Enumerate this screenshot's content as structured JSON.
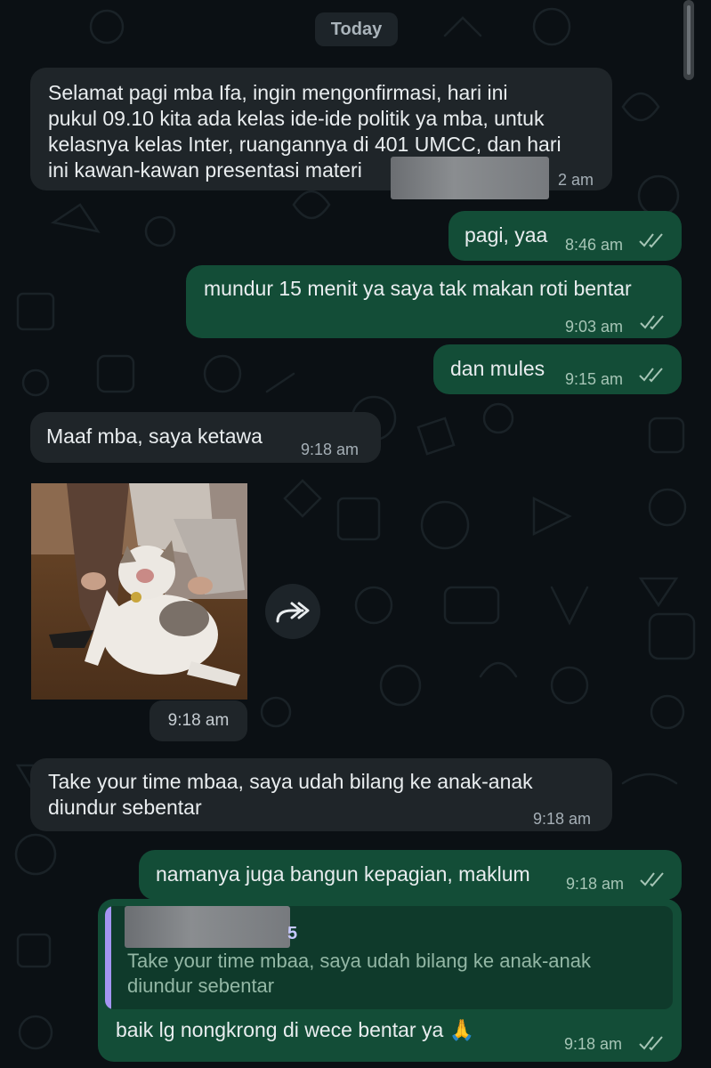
{
  "chat": {
    "date_label": "Today",
    "messages": [
      {
        "direction": "in",
        "text": "Selamat pagi mba Ifa, ingin mengonfirmasi, hari ini pukul 09.10 kita ada kelas ide-ide politik ya mba, untuk kelasnya kelas Inter, ruangannya di 401 UMCC, dan hari ini kawan-kawan presentasi materi",
        "lines": [
          "Selamat pagi mba Ifa, ingin mengonfirmasi, hari ini",
          "pukul 09.10 kita ada kelas ide-ide politik ya mba, untuk",
          "kelasnya kelas Inter, ruangannya di 401 UMCC, dan hari",
          "ini kawan-kawan presentasi materi"
        ],
        "time": "2 am"
      },
      {
        "direction": "out",
        "text": "pagi, yaa",
        "time": "8:46 am",
        "status": "read"
      },
      {
        "direction": "out",
        "text": "mundur 15 menit ya saya tak makan roti bentar",
        "time": "9:03 am",
        "status": "read"
      },
      {
        "direction": "out",
        "text": "dan mules",
        "time": "9:15 am",
        "status": "read"
      },
      {
        "direction": "in",
        "text": "Maaf mba, saya ketawa",
        "time": "9:18 am"
      },
      {
        "direction": "in",
        "type": "image",
        "image_icon": "cat-photo",
        "forward_icon": "forward-icon",
        "time": "9:18 am"
      },
      {
        "direction": "in",
        "text": "Take your time mbaa, saya udah bilang ke anak-anak diundur sebentar",
        "lines": [
          "Take your time mbaa, saya udah bilang ke anak-anak",
          "diundur sebentar"
        ],
        "time": "9:18 am"
      },
      {
        "direction": "out",
        "text": "namanya juga bangun kepagian, maklum",
        "time": "9:18 am",
        "status": "read"
      },
      {
        "direction": "out",
        "type": "reply",
        "quoted_name_suffix": "5",
        "quoted_lines": [
          "Take your time mbaa, saya udah bilang ke anak-anak",
          "diundur sebentar"
        ],
        "text": "baik lg nongkrong di wece bentar ya 🙏",
        "time": "9:18 am",
        "status": "read"
      }
    ]
  },
  "colors": {
    "background": "#0b1014",
    "incoming_bubble": "#1f2529",
    "outgoing_bubble": "#134d37",
    "quote_bar": "#a595f2"
  }
}
